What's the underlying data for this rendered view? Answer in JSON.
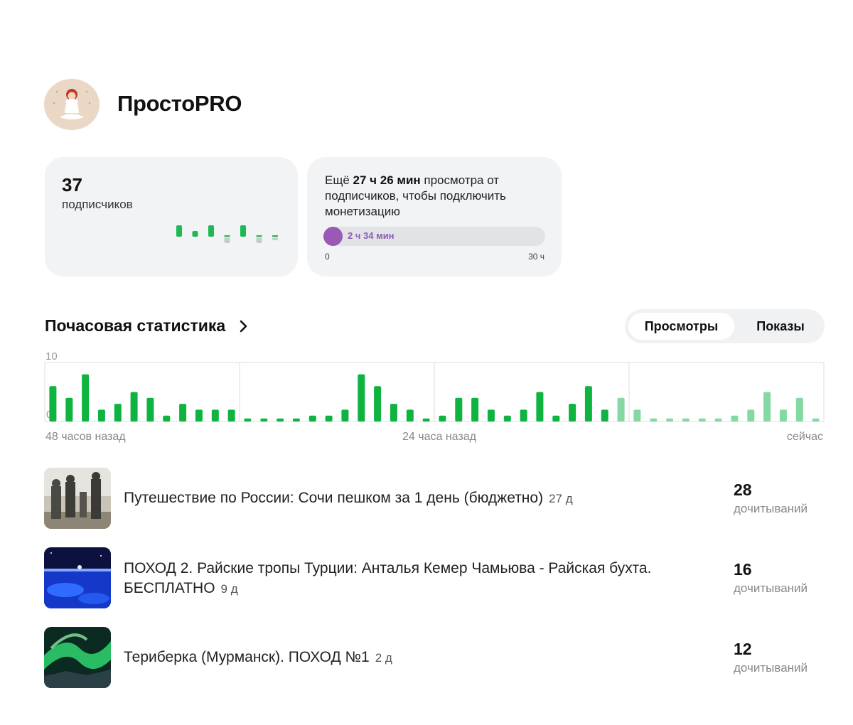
{
  "channel": {
    "name": "ПростоPRO"
  },
  "subscribers": {
    "count": "37",
    "label": "подписчиков"
  },
  "monetization": {
    "text_prefix": "Ещё ",
    "remaining": "27 ч 26 мин",
    "text_suffix": " просмотра от подписчиков, чтобы подключить монетизацию",
    "progress_label": "2 ч 34 мин",
    "progress_fraction": 0.085,
    "range_min": "0",
    "range_max": "30 ч"
  },
  "hourly": {
    "title": "Почасовая статистика",
    "tabs": {
      "views": "Просмотры",
      "impressions": "Показы"
    }
  },
  "chart_data": {
    "type": "bar",
    "y_max_label": "10",
    "y_min_label": "0",
    "ylim": [
      0,
      10
    ],
    "x_labels": [
      "48 часов назад",
      "24 часа назад",
      "сейчас"
    ],
    "values": [
      6,
      4,
      8,
      2,
      3,
      5,
      4,
      1,
      3,
      2,
      2,
      2,
      0.5,
      0.5,
      0.5,
      0.5,
      1,
      1,
      2,
      8,
      6,
      3,
      2,
      0.5,
      1,
      4,
      4,
      2,
      1,
      2,
      5,
      1,
      3,
      6,
      2,
      4,
      2,
      0.5,
      0.5,
      0.5,
      0.5,
      0.5,
      1,
      2,
      5,
      2,
      4,
      0.5
    ],
    "recent_from_index": 35,
    "colors": {
      "bar": "#0fb340",
      "bar_recent": "#84d9a2",
      "grid": "#dcdcdc"
    }
  },
  "mini_chart": {
    "values": [
      2,
      1,
      2,
      -1,
      2,
      -1,
      -0.5
    ],
    "colors": {
      "up": "#1db954",
      "down": "#c9c9c9"
    }
  },
  "articles": [
    {
      "title": "Путешествие по России: Сочи пешком за 1 день (бюджетно)",
      "age": "27 д",
      "count": "28",
      "count_label": "дочитываний"
    },
    {
      "title": "ПОХОД 2. Райские тропы Турции: Анталья Кемер Чамьюва - Райская бухта. БЕСПЛАТНО",
      "age": "9 д",
      "count": "16",
      "count_label": "дочитываний"
    },
    {
      "title": "Териберка (Мурманск). ПОХОД №1",
      "age": "2 д",
      "count": "12",
      "count_label": "дочитываний"
    }
  ]
}
